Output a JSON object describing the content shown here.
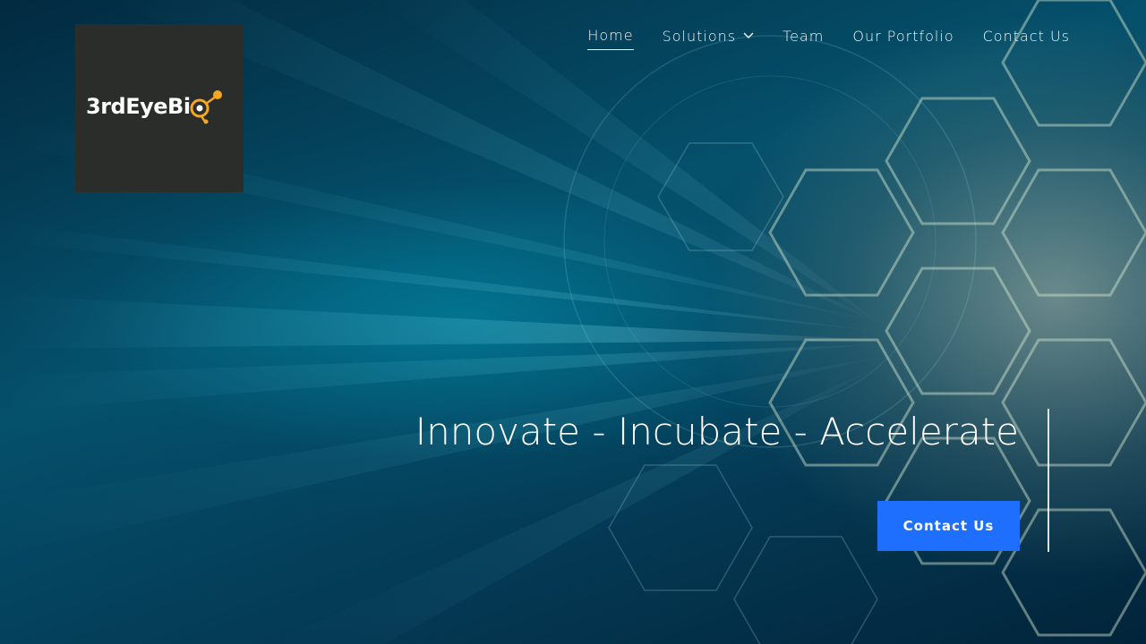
{
  "logo": {
    "text": "3rdEyeBi",
    "icon": "eye-molecule-icon",
    "accent": "#f5a623"
  },
  "nav": {
    "items": [
      {
        "label": "Home",
        "active": true
      },
      {
        "label": "Solutions",
        "has_dropdown": true,
        "icon": "chevron-down-icon"
      },
      {
        "label": "Team"
      },
      {
        "label": "Our Portfolio"
      },
      {
        "label": "Contact Us"
      }
    ]
  },
  "hero": {
    "headline": "Innovate - Incubate - Accelerate",
    "cta_label": "Contact Us",
    "cta_color": "#1f6fff"
  }
}
